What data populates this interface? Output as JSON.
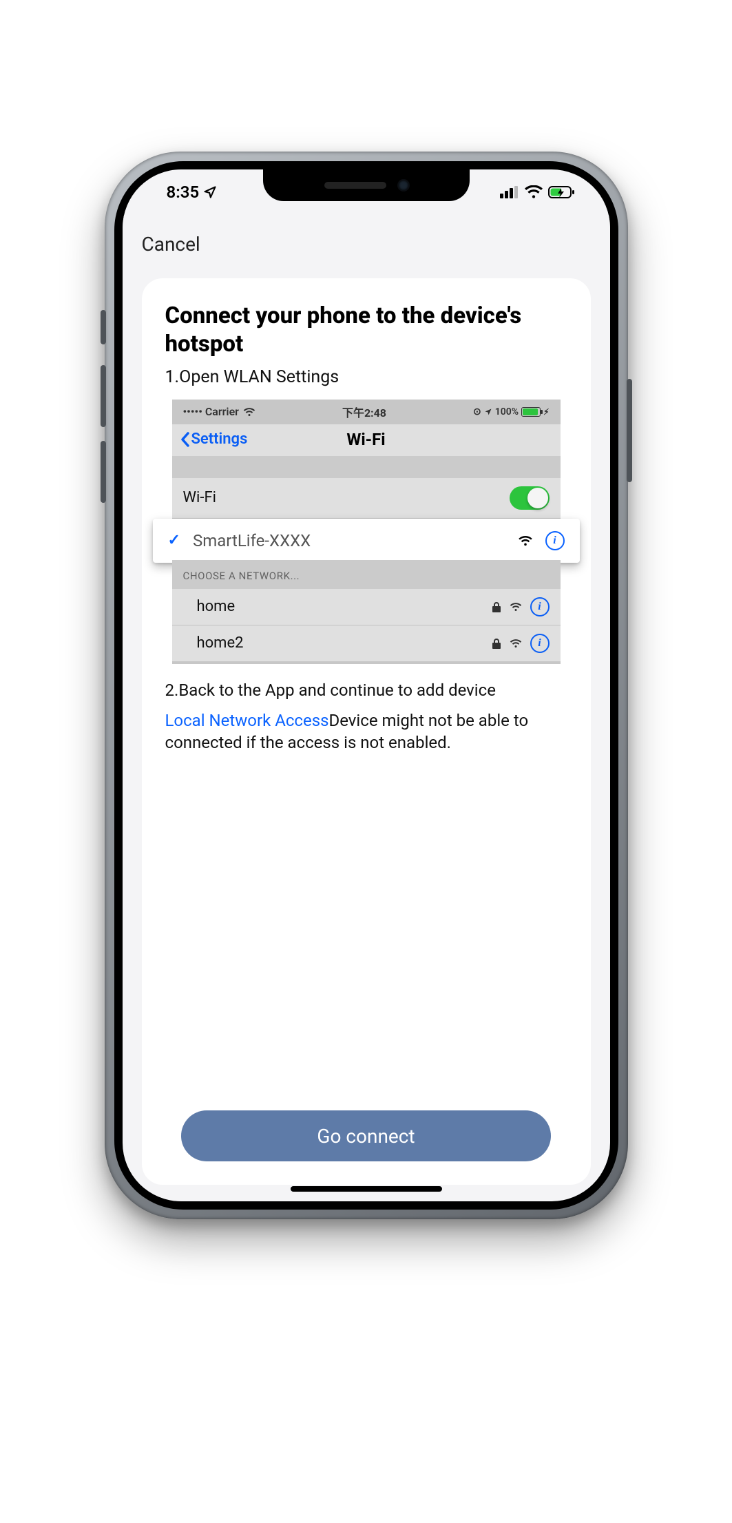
{
  "status_bar": {
    "time": "8:35"
  },
  "nav": {
    "cancel_label": "Cancel"
  },
  "card": {
    "title": "Connect your phone to the device's hotspot",
    "step1": "1.Open WLAN Settings",
    "step2": "2.Back to the App and continue to add device",
    "local_link": "Local Network Access",
    "local_text": "Device might not be able to connected if the access is not enabled."
  },
  "wifi_settings": {
    "carrier": "••••• Carrier",
    "time": "下午2:48",
    "battery": "100%",
    "back_label": "Settings",
    "title": "Wi-Fi",
    "toggle_label": "Wi-Fi",
    "selected_network": "SmartLife-XXXX",
    "choose_label": "CHOOSE A NETWORK...",
    "networks": [
      {
        "name": "home",
        "locked": true
      },
      {
        "name": "home2",
        "locked": true
      }
    ]
  },
  "cta": {
    "go_connect": "Go connect"
  }
}
